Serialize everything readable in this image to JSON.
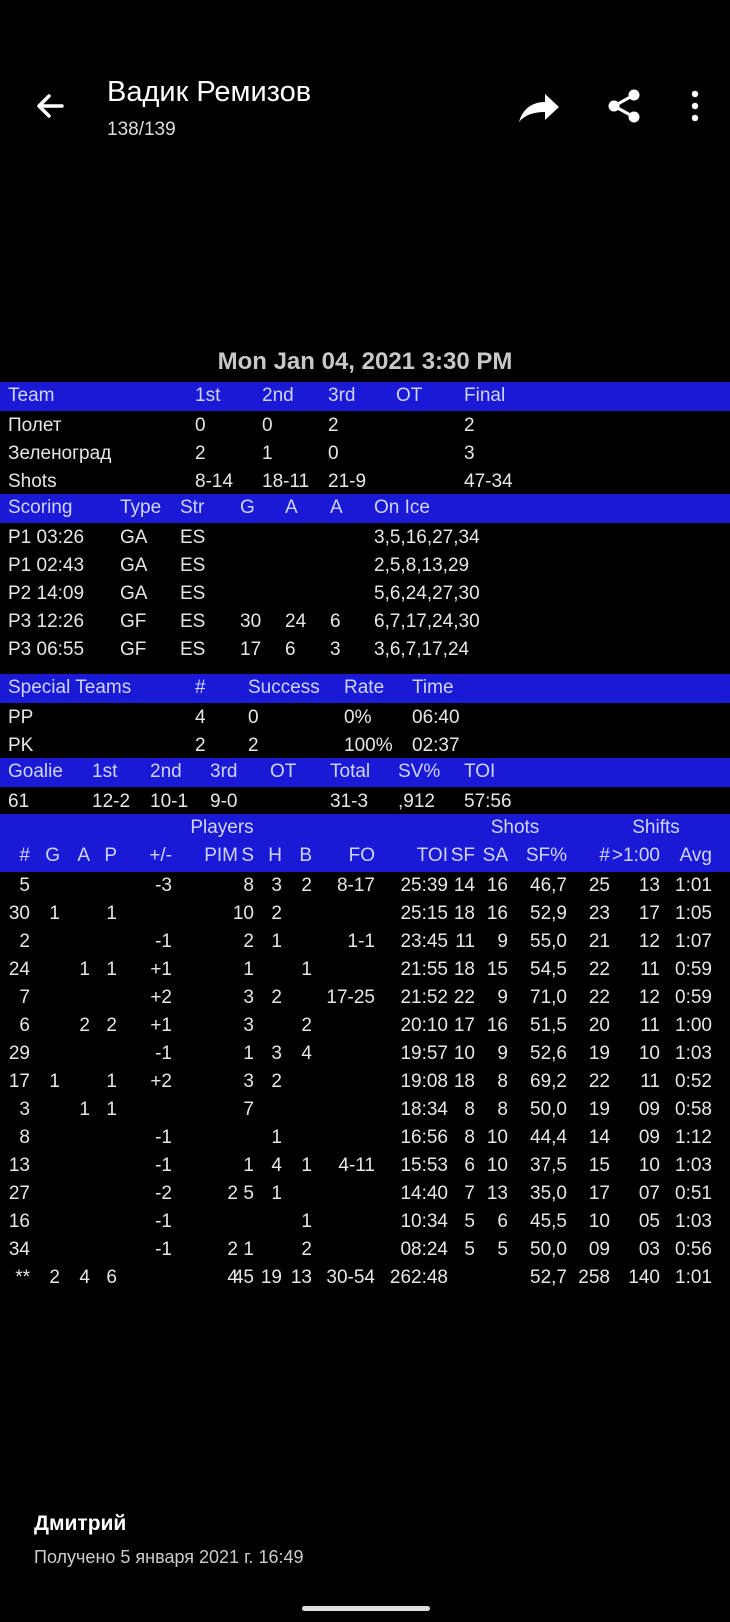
{
  "header": {
    "title": "Вадик Ремизов",
    "subtitle": "138/139",
    "back_icon": "arrow-left-icon",
    "forward_icon": "forward-arrow-icon",
    "share_icon": "share-icon",
    "more_icon": "more-vert-icon"
  },
  "report": {
    "date": "Mon Jan 04, 2021 3:30 PM",
    "team_header": [
      "Team",
      "1st",
      "2nd",
      "3rd",
      "OT",
      "Final"
    ],
    "team_rows": [
      [
        "Полет",
        "0",
        "0",
        "2",
        "",
        "2"
      ],
      [
        "Зеленоград",
        "2",
        "1",
        "0",
        "",
        "3"
      ],
      [
        "Shots",
        "8-14",
        "18-11",
        "21-9",
        "",
        "47-34"
      ]
    ],
    "scoring_header": [
      "Scoring",
      "Type",
      "Str",
      "G",
      "A",
      "A",
      "On Ice"
    ],
    "scoring_rows": [
      [
        "P1 03:26",
        "GA",
        "ES",
        "",
        "",
        "",
        "3,5,16,27,34"
      ],
      [
        "P1 02:43",
        "GA",
        "ES",
        "",
        "",
        "",
        "2,5,8,13,29"
      ],
      [
        "P2 14:09",
        "GA",
        "ES",
        "",
        "",
        "",
        "5,6,24,27,30"
      ],
      [
        "P3 12:26",
        "GF",
        "ES",
        "30",
        "24",
        "6",
        "6,7,17,24,30"
      ],
      [
        "P3 06:55",
        "GF",
        "ES",
        "17",
        "6",
        "3",
        "3,6,7,17,24"
      ]
    ],
    "special_header": [
      "Special Teams",
      "#",
      "Success",
      "Rate",
      "Time"
    ],
    "special_rows": [
      [
        "PP",
        "4",
        "0",
        "0%",
        "06:40"
      ],
      [
        "PK",
        "2",
        "2",
        "100%",
        "02:37"
      ]
    ],
    "goalie_header": [
      "Goalie",
      "1st",
      "2nd",
      "3rd",
      "OT",
      "Total",
      "SV%",
      "TOI"
    ],
    "goalie_rows": [
      [
        "61",
        "12-2",
        "10-1",
        "9-0",
        "",
        "31-3",
        ",912",
        "57:56"
      ]
    ],
    "players_group_header": [
      "Players",
      "Shots",
      "Shifts"
    ],
    "players_header": [
      "#",
      "G",
      "A",
      "P",
      "+/-",
      "PIM",
      "S",
      "H",
      "B",
      "FO",
      "TOI",
      "SF",
      "SA",
      "SF%",
      "#",
      ">1:00",
      "Avg"
    ],
    "player_rows": [
      [
        "5",
        "",
        "",
        "",
        "-3",
        "",
        "8",
        "3",
        "2",
        "8-17",
        "25:39",
        "14",
        "16",
        "46,7",
        "25",
        "13",
        "1:01"
      ],
      [
        "30",
        "1",
        "",
        "1",
        "",
        "",
        "10",
        "2",
        "",
        "",
        "25:15",
        "18",
        "16",
        "52,9",
        "23",
        "17",
        "1:05"
      ],
      [
        "2",
        "",
        "",
        "",
        "-1",
        "",
        "2",
        "1",
        "",
        "1-1",
        "23:45",
        "11",
        "9",
        "55,0",
        "21",
        "12",
        "1:07"
      ],
      [
        "24",
        "",
        "1",
        "1",
        "+1",
        "",
        "1",
        "",
        "1",
        "",
        "21:55",
        "18",
        "15",
        "54,5",
        "22",
        "11",
        "0:59"
      ],
      [
        "7",
        "",
        "",
        "",
        "+2",
        "",
        "3",
        "2",
        "",
        "17-25",
        "21:52",
        "22",
        "9",
        "71,0",
        "22",
        "12",
        "0:59"
      ],
      [
        "6",
        "",
        "2",
        "2",
        "+1",
        "",
        "3",
        "",
        "2",
        "",
        "20:10",
        "17",
        "16",
        "51,5",
        "20",
        "11",
        "1:00"
      ],
      [
        "29",
        "",
        "",
        "",
        "-1",
        "",
        "1",
        "3",
        "4",
        "",
        "19:57",
        "10",
        "9",
        "52,6",
        "19",
        "10",
        "1:03"
      ],
      [
        "17",
        "1",
        "",
        "1",
        "+2",
        "",
        "3",
        "2",
        "",
        "",
        "19:08",
        "18",
        "8",
        "69,2",
        "22",
        "11",
        "0:52"
      ],
      [
        "3",
        "",
        "1",
        "1",
        "",
        "",
        "7",
        "",
        "",
        "",
        "18:34",
        "8",
        "8",
        "50,0",
        "19",
        "09",
        "0:58"
      ],
      [
        "8",
        "",
        "",
        "",
        "-1",
        "",
        "",
        "1",
        "",
        "",
        "16:56",
        "8",
        "10",
        "44,4",
        "14",
        "09",
        "1:12"
      ],
      [
        "13",
        "",
        "",
        "",
        "-1",
        "",
        "1",
        "4",
        "1",
        "4-11",
        "15:53",
        "6",
        "10",
        "37,5",
        "15",
        "10",
        "1:03"
      ],
      [
        "27",
        "",
        "",
        "",
        "-2",
        "2",
        "5",
        "1",
        "",
        "",
        "14:40",
        "7",
        "13",
        "35,0",
        "17",
        "07",
        "0:51"
      ],
      [
        "16",
        "",
        "",
        "",
        "-1",
        "",
        "",
        "",
        "1",
        "",
        "10:34",
        "5",
        "6",
        "45,5",
        "10",
        "05",
        "1:03"
      ],
      [
        "34",
        "",
        "",
        "",
        "-1",
        "2",
        "1",
        "",
        "2",
        "",
        "08:24",
        "5",
        "5",
        "50,0",
        "09",
        "03",
        "0:56"
      ],
      [
        "**",
        "2",
        "4",
        "6",
        "",
        "4",
        "45",
        "19",
        "13",
        "30-54",
        "262:48",
        "",
        "",
        "52,7",
        "258",
        "140",
        "1:01"
      ]
    ]
  },
  "footer": {
    "sender": "Дмитрий",
    "received": "Получено 5 января 2021 г. 16:49"
  }
}
